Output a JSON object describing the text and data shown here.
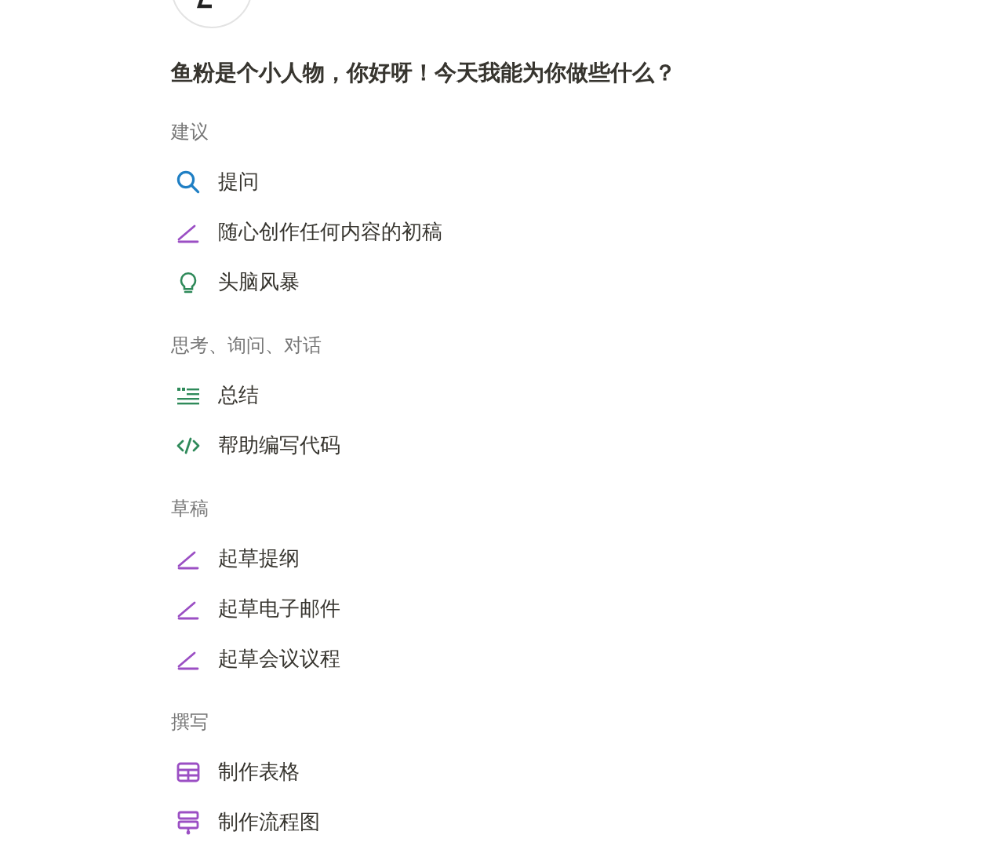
{
  "greeting": "鱼粉是个小人物，你好呀！今天我能为你做些什么？",
  "sections": [
    {
      "title": "建议",
      "items": [
        {
          "kind": "search",
          "label": "提问"
        },
        {
          "kind": "pen",
          "label": "随心创作任何内容的初稿"
        },
        {
          "kind": "bulb",
          "label": "头脑风暴"
        }
      ]
    },
    {
      "title": "思考、询问、对话",
      "items": [
        {
          "kind": "summary",
          "label": "总结"
        },
        {
          "kind": "code",
          "label": "帮助编写代码"
        }
      ]
    },
    {
      "title": "草稿",
      "items": [
        {
          "kind": "pen",
          "label": "起草提纲"
        },
        {
          "kind": "pen",
          "label": "起草电子邮件"
        },
        {
          "kind": "pen",
          "label": "起草会议议程"
        }
      ]
    },
    {
      "title": "撰写",
      "items": [
        {
          "kind": "table",
          "label": "制作表格"
        },
        {
          "kind": "flowchart",
          "label": "制作流程图"
        }
      ]
    }
  ]
}
